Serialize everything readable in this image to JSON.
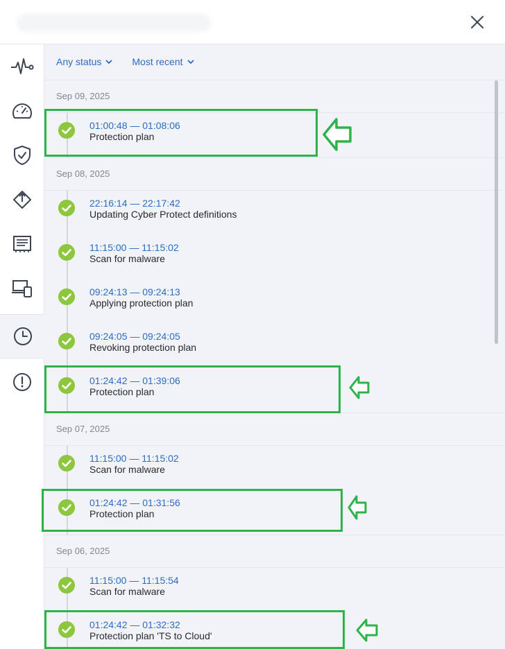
{
  "header": {
    "close_icon": "close-icon"
  },
  "rail": {
    "items": [
      {
        "icon": "activity-pulse-icon"
      },
      {
        "icon": "speedometer-icon"
      },
      {
        "icon": "shield-check-icon"
      },
      {
        "icon": "deploy-arrows-icon"
      },
      {
        "icon": "document-list-icon"
      },
      {
        "icon": "devices-icon"
      },
      {
        "icon": "clock-icon",
        "active": true
      },
      {
        "icon": "alert-circle-icon"
      }
    ]
  },
  "filters": {
    "status": "Any status",
    "sort": "Most recent"
  },
  "groups": [
    {
      "date": "Sep 09, 2025",
      "entries": [
        {
          "time": "01:00:48 — 01:08:06",
          "title": "Protection plan"
        }
      ]
    },
    {
      "date": "Sep 08, 2025",
      "entries": [
        {
          "time": "22:16:14 — 22:17:42",
          "title": "Updating Cyber Protect definitions"
        },
        {
          "time": "11:15:00 — 11:15:02",
          "title": "Scan for malware"
        },
        {
          "time": "09:24:13 — 09:24:13",
          "title": "Applying protection plan"
        },
        {
          "time": "09:24:05 — 09:24:05",
          "title": "Revoking protection plan"
        },
        {
          "time": "01:24:42 — 01:39:06",
          "title": "Protection plan"
        }
      ]
    },
    {
      "date": "Sep 07, 2025",
      "entries": [
        {
          "time": "11:15:00 — 11:15:02",
          "title": "Scan for malware"
        },
        {
          "time": "01:24:42 — 01:31:56",
          "title": "Protection plan"
        }
      ]
    },
    {
      "date": "Sep 06, 2025",
      "entries": [
        {
          "time": "11:15:00 — 11:15:54",
          "title": "Scan for malware"
        },
        {
          "time": "01:24:42 — 01:32:32",
          "title": "Protection plan 'TS to Cloud'"
        }
      ]
    }
  ],
  "colors": {
    "accent": "#2b6cc4",
    "success": "#8dc63f",
    "highlight": "#2eb34a"
  }
}
